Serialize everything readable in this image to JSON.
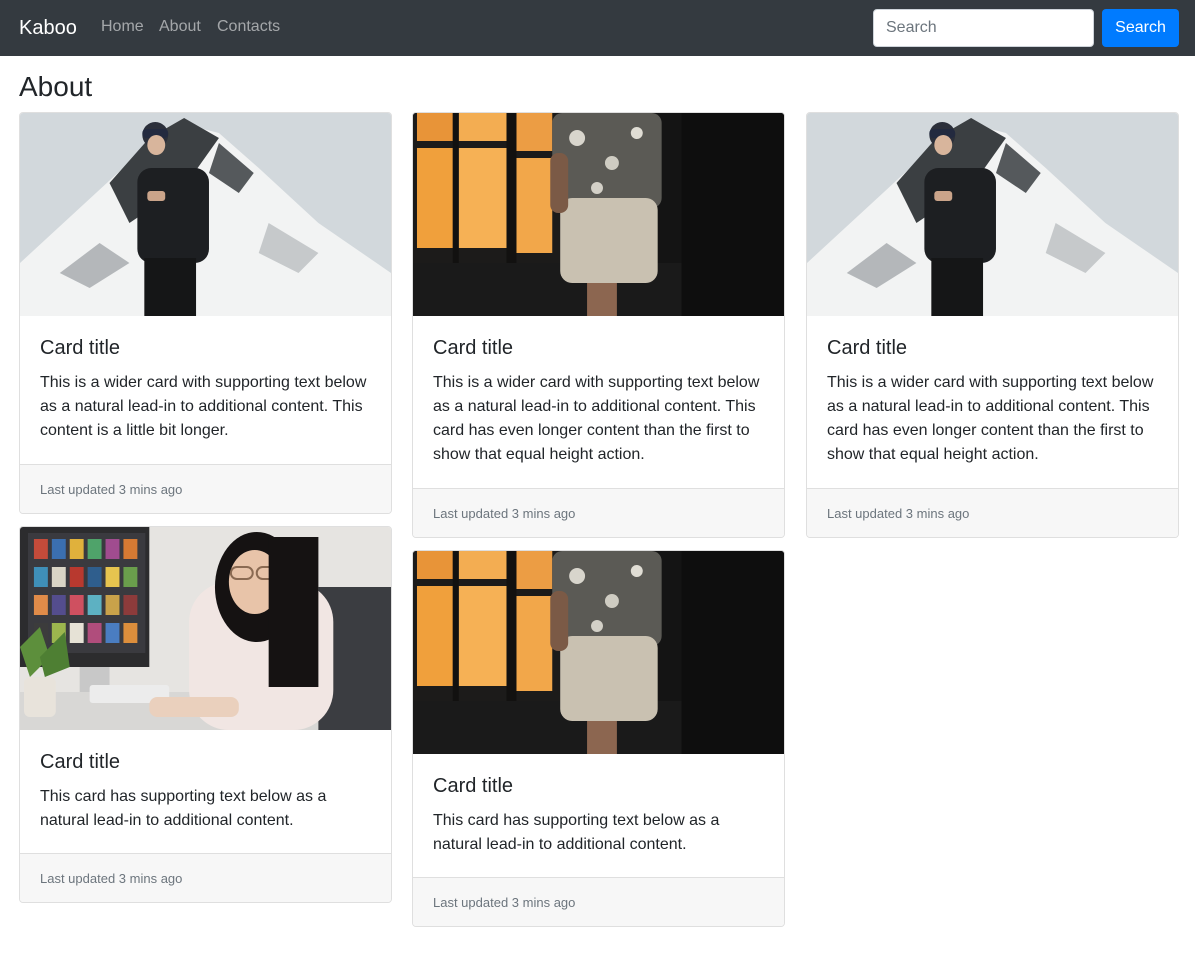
{
  "navbar": {
    "brand": "Kaboo",
    "links": [
      "Home",
      "About",
      "Contacts"
    ],
    "search_placeholder": "Search",
    "search_button": "Search"
  },
  "page": {
    "title": "About"
  },
  "cards": [
    {
      "image": "snowy-mountain-man-photo",
      "title": "Card title",
      "text": "This is a wider card with supporting text below as a natural lead-in to additional content. This content is a little bit longer.",
      "footer": "Last updated 3 mins ago"
    },
    {
      "image": "man-shorts-window-photo",
      "title": "Card title",
      "text": "This is a wider card with supporting text below as a natural lead-in to additional content. This card has even longer content than the first to show that equal height action.",
      "footer": "Last updated 3 mins ago"
    },
    {
      "image": "snowy-mountain-man-photo",
      "title": "Card title",
      "text": "This is a wider card with supporting text below as a natural lead-in to additional content. This card has even longer content than the first to show that equal height action.",
      "footer": "Last updated 3 mins ago"
    },
    {
      "image": "woman-at-desk-photo",
      "title": "Card title",
      "text": "This card has supporting text below as a natural lead-in to additional content.",
      "footer": "Last updated 3 mins ago"
    },
    {
      "image": "man-shorts-window-photo",
      "title": "Card title",
      "text": "This card has supporting text below as a natural lead-in to additional content.",
      "footer": "Last updated 3 mins ago"
    }
  ]
}
